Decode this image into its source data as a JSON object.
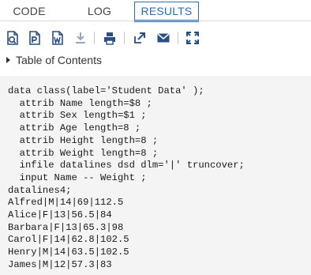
{
  "tabs": [
    {
      "label": "CODE",
      "active": false
    },
    {
      "label": "LOG",
      "active": false
    },
    {
      "label": "RESULTS",
      "active": true
    }
  ],
  "toolbar": {
    "icons": [
      "download-html-icon",
      "download-pdf-icon",
      "download-rtf-icon",
      "download-icon",
      "print-icon",
      "open-new-window-icon",
      "email-icon",
      "expand-icon"
    ],
    "accent": "#2a6fb5"
  },
  "toc": {
    "label": "Table of Contents"
  },
  "code": {
    "lines": [
      "data class(label='Student Data' );",
      "  attrib Name length=$8 ;",
      "  attrib Sex length=$1 ;",
      "  attrib Age length=8 ;",
      "  attrib Height length=8 ;",
      "  attrib Weight length=8 ;",
      "  infile datalines dsd dlm='|' truncover;",
      "  input Name -- Weight ;",
      "datalines4;",
      "Alfred|M|14|69|112.5",
      "Alice|F|13|56.5|84",
      "Barbara|F|13|65.3|98",
      "Carol|F|14|62.8|102.5",
      "Henry|M|14|63.5|102.5",
      "James|M|12|57.3|83"
    ]
  }
}
